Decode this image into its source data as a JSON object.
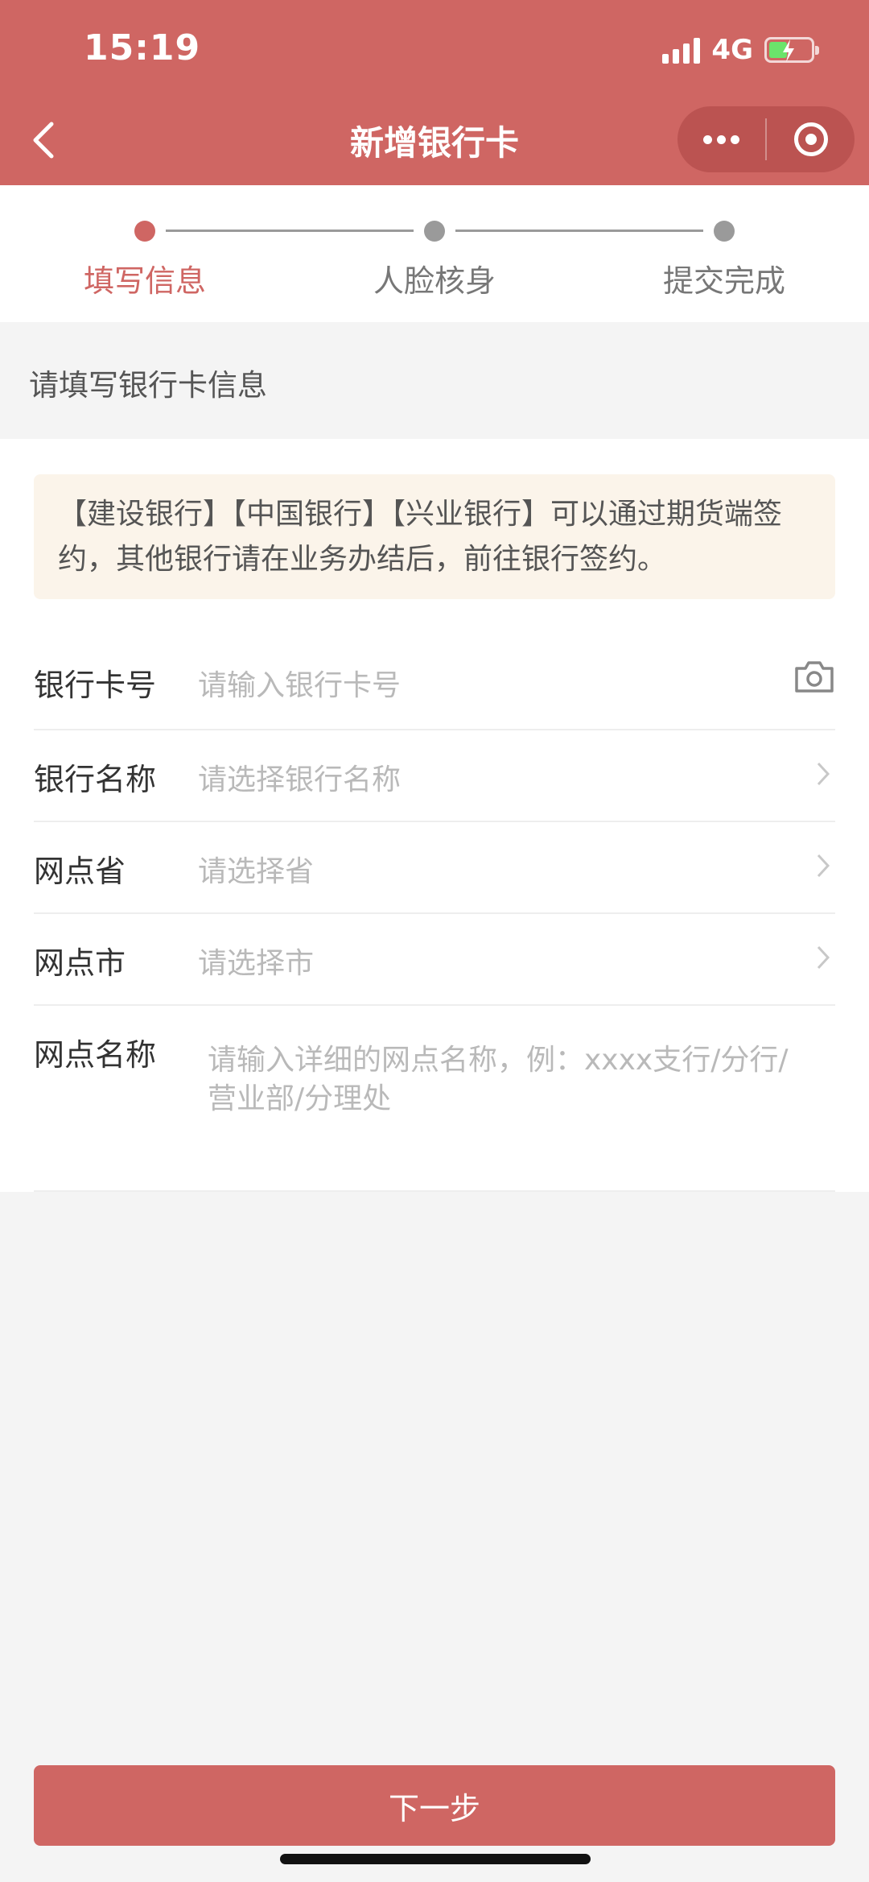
{
  "status_bar": {
    "time": "15:19",
    "network": "4G"
  },
  "nav": {
    "title": "新增银行卡",
    "accent": "#cf6663"
  },
  "steps": [
    {
      "label": "填写信息",
      "active": true
    },
    {
      "label": "人脸核身",
      "active": false
    },
    {
      "label": "提交完成",
      "active": false
    }
  ],
  "section": {
    "title": "请填写银行卡信息"
  },
  "notice": {
    "text": "【建设银行】【中国银行】【兴业银行】可以通过期货端签约，其他银行请在业务办结后，前往银行签约。"
  },
  "fields": [
    {
      "label": "银行卡号",
      "placeholder": "请输入银行卡号",
      "icon": "camera-icon"
    },
    {
      "label": "银行名称",
      "placeholder": "请选择银行名称",
      "icon": "chevron-right-icon"
    },
    {
      "label": "网点省",
      "placeholder": "请选择省",
      "icon": "chevron-right-icon"
    },
    {
      "label": "网点市",
      "placeholder": "请选择市",
      "icon": "chevron-right-icon"
    },
    {
      "label": "网点名称",
      "placeholder": "请输入详细的网点名称，例：xxxx支行/分行/营业部/分理处"
    }
  ],
  "footer": {
    "next_label": "下一步"
  }
}
